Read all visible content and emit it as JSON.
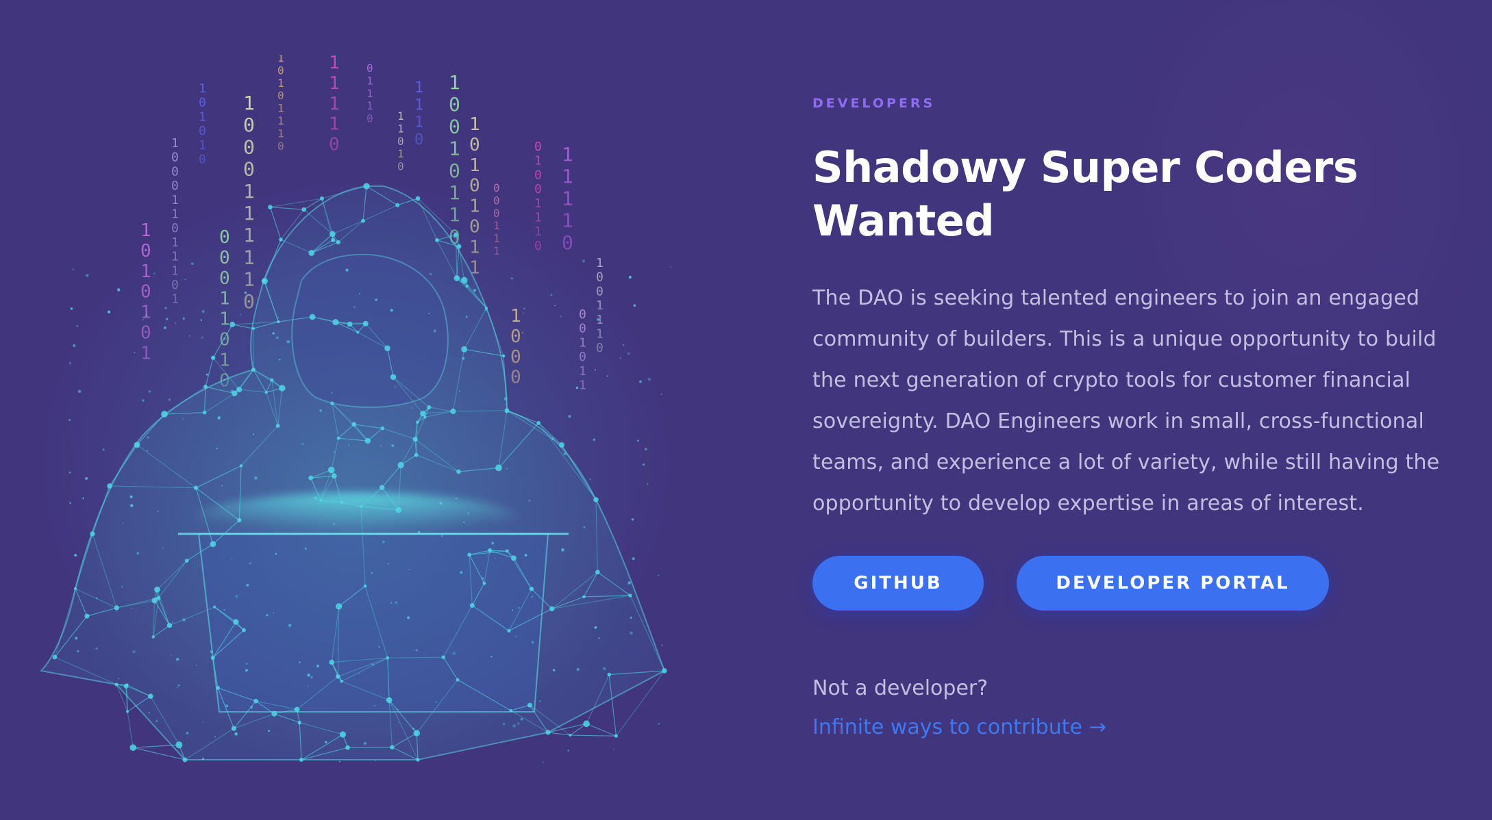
{
  "colors": {
    "background": "#41357e",
    "eyebrow": "#8f6cf2",
    "title": "#ffffff",
    "body_text": "#c3bfe0",
    "button_bg": "#3b70f0",
    "link": "#3d79f2",
    "network": "#4fd6e6"
  },
  "illustration": {
    "icon": "hooded-hacker-network-icon",
    "binary_columns": [
      {
        "digits": "1010101",
        "color": "#b46ad6"
      },
      {
        "digits": "100011011101",
        "color": "#9b8fd0"
      },
      {
        "digits": "101010",
        "color": "#5a63e6"
      },
      {
        "digits": "00011010",
        "color": "#8fc8a8"
      },
      {
        "digits": "1000111110",
        "color": "#c9d2a6"
      },
      {
        "digits": "10101110",
        "color": "#c9a080"
      },
      {
        "digits": "11110",
        "color": "#c04cb4"
      },
      {
        "digits": "01110",
        "color": "#a46ad6"
      },
      {
        "digits": "11010",
        "color": "#c5bfa8"
      },
      {
        "digits": "1110",
        "color": "#5a5fe6"
      },
      {
        "digits": "10010110",
        "color": "#8ed3a0"
      },
      {
        "digits": "10101011",
        "color": "#c9c2a0"
      },
      {
        "digits": "000111",
        "color": "#c06fa0"
      },
      {
        "digits": "1000",
        "color": "#c3a88a"
      },
      {
        "digits": "01001110",
        "color": "#c04cb4"
      },
      {
        "digits": "11110",
        "color": "#a25ad0"
      },
      {
        "digits": "001011",
        "color": "#a888c8"
      },
      {
        "digits": "1001110",
        "color": "#a7a6c8"
      }
    ]
  },
  "section": {
    "eyebrow": "DEVELOPERS",
    "title_line1": "Shadowy Super Coders",
    "title_line2": "Wanted",
    "body_lines": [
      "The DAO is seeking talented engineers to join an engaged",
      "community of builders. This is a unique opportunity to build",
      "the next generation of crypto tools for customer financial",
      "sovereignty. DAO Engineers work in small, cross-functional",
      "teams, and experience a lot of variety, while still having the",
      "opportunity to develop expertise in areas of interest."
    ],
    "buttons": {
      "github": "GITHUB",
      "portal": "DEVELOPER PORTAL"
    },
    "not_developer": "Not a developer?",
    "contribute_link": "Infinite ways to contribute",
    "contribute_arrow": "→",
    "arrow_icon": "arrow-right-icon"
  }
}
